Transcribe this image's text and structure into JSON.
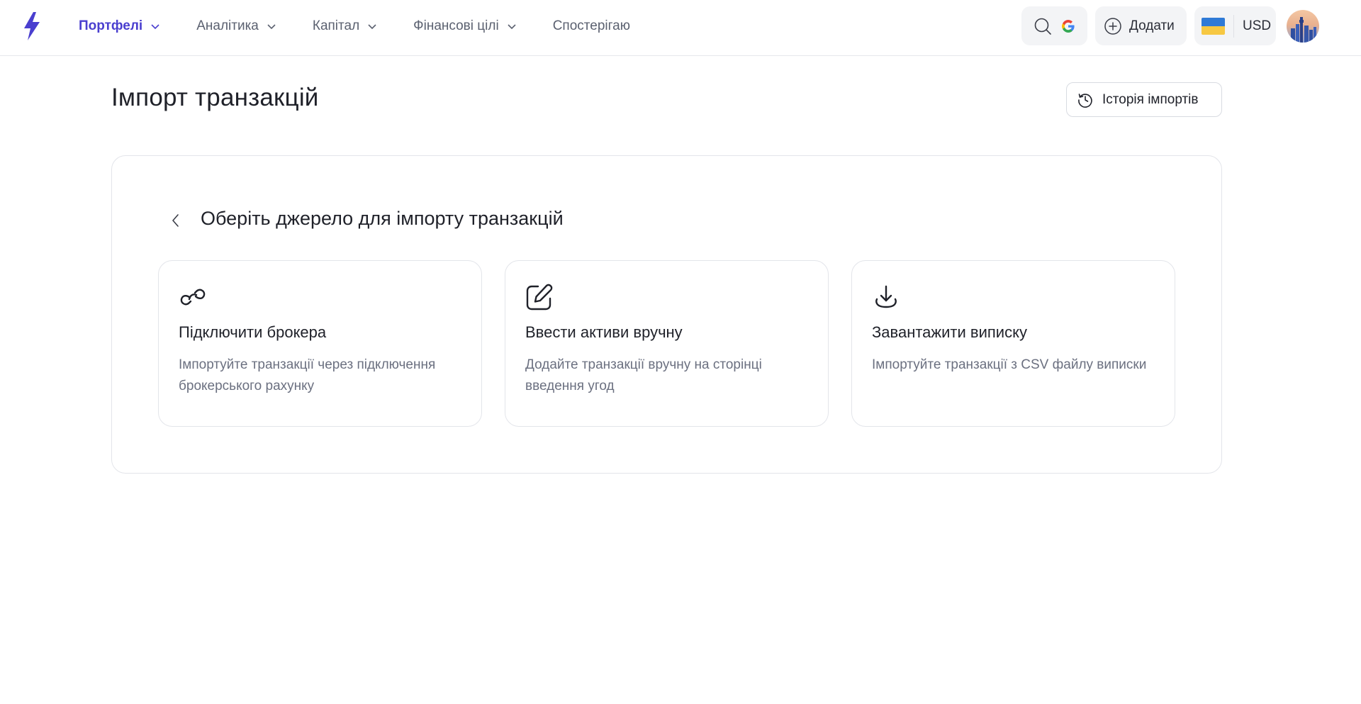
{
  "nav": {
    "items": [
      {
        "label": "Портфелі",
        "active": true,
        "has_dropdown": true
      },
      {
        "label": "Аналітика",
        "active": false,
        "has_dropdown": true
      },
      {
        "label": "Капітал",
        "active": false,
        "has_dropdown": true
      },
      {
        "label": "Фінансові цілі",
        "active": false,
        "has_dropdown": true
      },
      {
        "label": "Спостерігаю",
        "active": false,
        "has_dropdown": false
      }
    ]
  },
  "header": {
    "add_label": "Додати",
    "currency": "USD",
    "icons": [
      "logo-bolt-icon",
      "search-icon",
      "google-icon",
      "plus-circle-icon",
      "ukraine-flag-icon",
      "avatar"
    ]
  },
  "page": {
    "title": "Імпорт транзакцій",
    "history_button": "Історія імпортів"
  },
  "card": {
    "heading": "Оберіть джерело для імпорту транзакцій",
    "options": [
      {
        "icon": "link-icon",
        "title": "Підключити брокера",
        "description": "Імпортуйте транзакції через підключення брокерського рахунку"
      },
      {
        "icon": "edit-icon",
        "title": "Ввести активи вручну",
        "description": "Додайте транзакції вручну на сторінці введення угод"
      },
      {
        "icon": "download-icon",
        "title": "Завантажити виписку",
        "description": "Імпортуйте транзакції з CSV файлу виписки"
      }
    ]
  },
  "colors": {
    "accent": "#4a3fcf",
    "text": "#1f2129",
    "muted": "#6b7080",
    "border": "#e3e5ea"
  }
}
